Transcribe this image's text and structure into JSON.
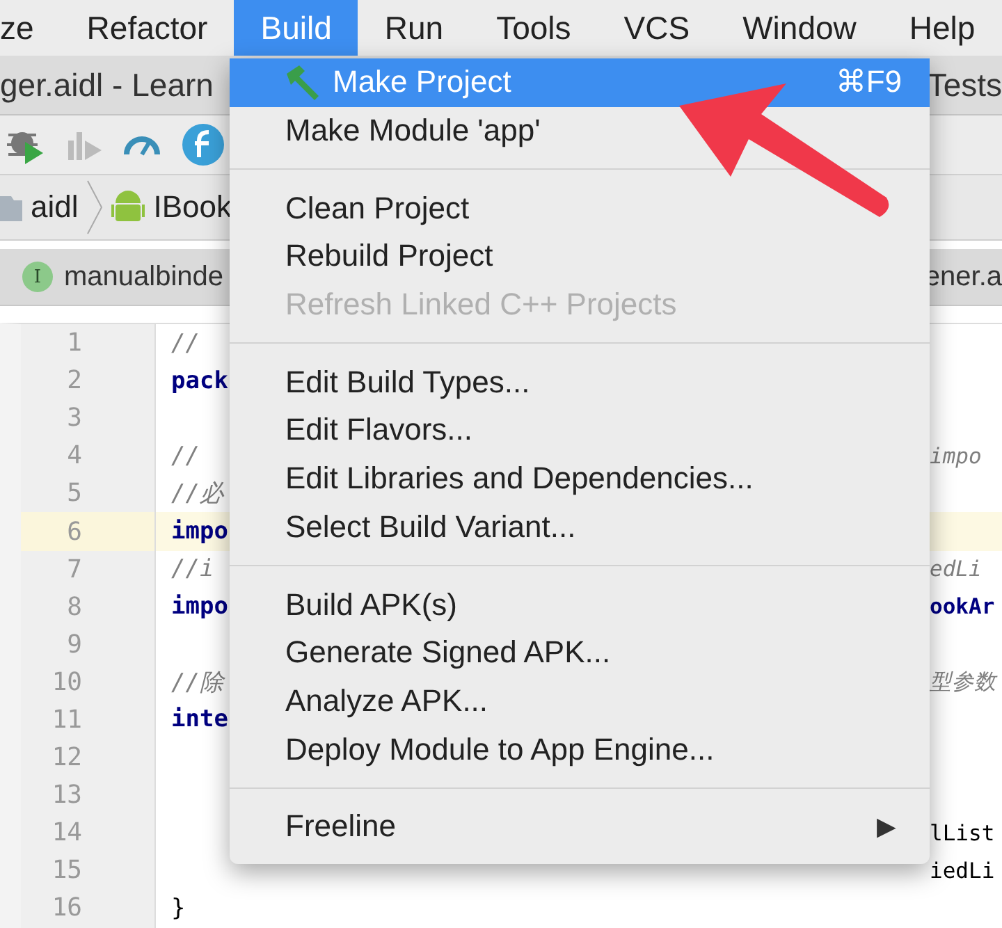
{
  "menubar": [
    {
      "label": "ze",
      "selected": false
    },
    {
      "label": "Refactor",
      "selected": false
    },
    {
      "label": "Build",
      "selected": true
    },
    {
      "label": "Run",
      "selected": false
    },
    {
      "label": "Tools",
      "selected": false
    },
    {
      "label": "VCS",
      "selected": false
    },
    {
      "label": "Window",
      "selected": false
    },
    {
      "label": "Help",
      "selected": false
    }
  ],
  "title_bar": {
    "left": "ger.aidl - Learn",
    "right": "Tests"
  },
  "breadcrumb": [
    {
      "label": "aidl",
      "kind": "folder"
    },
    {
      "label": "IBook",
      "kind": "android"
    }
  ],
  "tabs": [
    {
      "label": "manualbinde",
      "badge": "I"
    },
    {
      "label": "ener.a"
    }
  ],
  "editor": {
    "lines": [
      {
        "number": "1",
        "text": "//",
        "kind": "comment",
        "current": false
      },
      {
        "number": "2",
        "text": "pack",
        "kind": "keyword",
        "current": false
      },
      {
        "number": "3",
        "kind": "plain",
        "current": false
      },
      {
        "number": "4",
        "text": "//",
        "right": "impo",
        "kind": "comment",
        "current": false
      },
      {
        "number": "5",
        "text": "//必",
        "kind": "comment",
        "current": false
      },
      {
        "number": "6",
        "text": "impo",
        "kind": "keyword",
        "current": true
      },
      {
        "number": "7",
        "text": "//i",
        "right": "edLi",
        "kind": "comment",
        "current": false
      },
      {
        "number": "8",
        "text": "impo",
        "right": "ookAr",
        "kind": "keyword",
        "current": false
      },
      {
        "number": "9",
        "kind": "plain",
        "current": false
      },
      {
        "number": "10",
        "text": "//除",
        "right": "型参数",
        "kind": "comment",
        "current": false
      },
      {
        "number": "11",
        "text": "inte",
        "kind": "keyword",
        "current": false
      },
      {
        "number": "12",
        "kind": "plain",
        "current": false
      },
      {
        "number": "13",
        "kind": "plain",
        "current": false
      },
      {
        "number": "14",
        "right": "lList",
        "kind": "plain",
        "current": false
      },
      {
        "number": "15",
        "right": "iedLi",
        "kind": "plain",
        "current": false
      },
      {
        "number": "16",
        "text": "}",
        "kind": "plain",
        "current": false
      }
    ]
  },
  "build_menu": {
    "groups": [
      [
        {
          "label": "Make Project",
          "shortcut": "⌘F9",
          "kind": "hammer",
          "selected": true,
          "disabled": false,
          "submenu": false
        },
        {
          "label": "Make Module 'app'",
          "selected": false,
          "disabled": false,
          "submenu": false
        }
      ],
      [
        {
          "label": "Clean Project",
          "selected": false,
          "disabled": false,
          "submenu": false
        },
        {
          "label": "Rebuild Project",
          "selected": false,
          "disabled": false,
          "submenu": false
        },
        {
          "label": "Refresh Linked C++ Projects",
          "selected": false,
          "disabled": true,
          "submenu": false
        }
      ],
      [
        {
          "label": "Edit Build Types...",
          "selected": false,
          "disabled": false,
          "submenu": false
        },
        {
          "label": "Edit Flavors...",
          "selected": false,
          "disabled": false,
          "submenu": false
        },
        {
          "label": "Edit Libraries and Dependencies...",
          "selected": false,
          "disabled": false,
          "submenu": false
        },
        {
          "label": "Select Build Variant...",
          "selected": false,
          "disabled": false,
          "submenu": false
        }
      ],
      [
        {
          "label": "Build APK(s)",
          "selected": false,
          "disabled": false,
          "submenu": false
        },
        {
          "label": "Generate Signed APK...",
          "selected": false,
          "disabled": false,
          "submenu": false
        },
        {
          "label": "Analyze APK...",
          "selected": false,
          "disabled": false,
          "submenu": false
        },
        {
          "label": "Deploy Module to App Engine...",
          "selected": false,
          "disabled": false,
          "submenu": false
        }
      ],
      [
        {
          "label": "Freeline",
          "selected": false,
          "disabled": false,
          "submenu": true,
          "submenu_mark": "▶"
        }
      ]
    ]
  }
}
